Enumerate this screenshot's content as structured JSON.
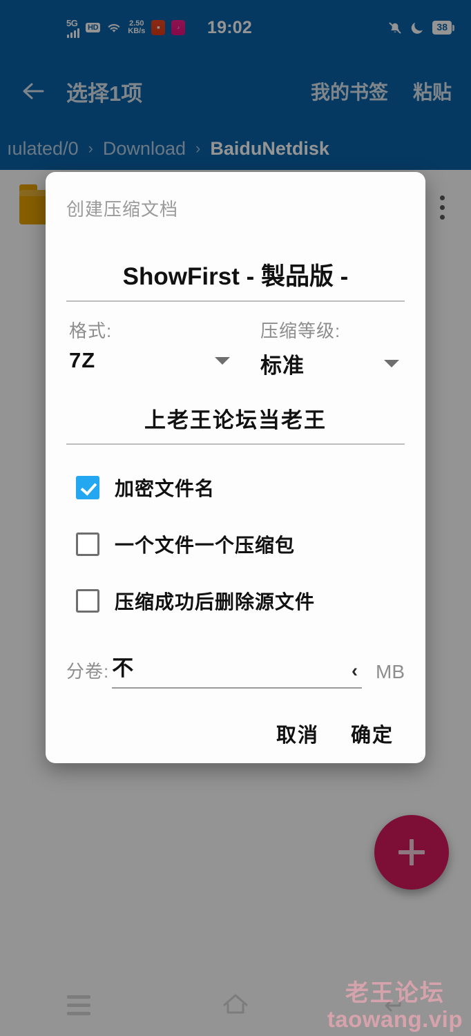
{
  "statusbar": {
    "network_type": "5G",
    "hd_badge": "HD",
    "net_speed_value": "2.50",
    "net_speed_unit": "KB/s",
    "clock": "19:02",
    "battery_percent": "38",
    "icons": [
      "signal-bars-icon",
      "hd-icon",
      "wifi-icon",
      "network-speed-icon",
      "app-notification-red-icon",
      "app-notification-pink-icon",
      "bell-muted-icon",
      "do-not-disturb-moon-icon",
      "battery-icon"
    ]
  },
  "toolbar": {
    "back_icon": "←",
    "title": "选择1项",
    "action_bookmarks": "我的书签",
    "action_paste": "粘贴"
  },
  "breadcrumb": {
    "items": [
      {
        "label": "ıulated/0",
        "active": false
      },
      {
        "label": "Download",
        "active": false
      },
      {
        "label": "BaiduNetdisk",
        "active": true
      }
    ],
    "separator": "›"
  },
  "filelist": {
    "rows": [
      {
        "name": "",
        "sub": ""
      }
    ]
  },
  "fab": {
    "icon": "plus-icon",
    "label": "+"
  },
  "navbar": {
    "recents_label": "recents-icon",
    "home_label": "home-icon",
    "back_label": "back-icon"
  },
  "dialog": {
    "title": "创建压缩文档",
    "filename": "ShowFirst - 製品版 -",
    "format": {
      "label": "格式:",
      "value": "7Z"
    },
    "level": {
      "label": "压缩等级:",
      "value": "标准"
    },
    "password": {
      "value": "上老王论坛当老王",
      "placeholder": ""
    },
    "checkboxes": [
      {
        "label": "加密文件名",
        "checked": true
      },
      {
        "label": "一个文件一个压缩包",
        "checked": false
      },
      {
        "label": "压缩成功后删除源文件",
        "checked": false
      }
    ],
    "split": {
      "label": "分卷:",
      "value": "不",
      "chevron": "‹",
      "unit": "MB"
    },
    "cancel": "取消",
    "confirm": "确定"
  },
  "watermark": {
    "cn": "老王论坛",
    "en": "taowang.vip"
  },
  "colors": {
    "header_blue": "#0b63a8",
    "accent_checkbox": "#22a7f0",
    "fab_pink": "#d81b60",
    "folder_orange": "#e8a200",
    "watermark_pink": "#f0a9b7"
  }
}
